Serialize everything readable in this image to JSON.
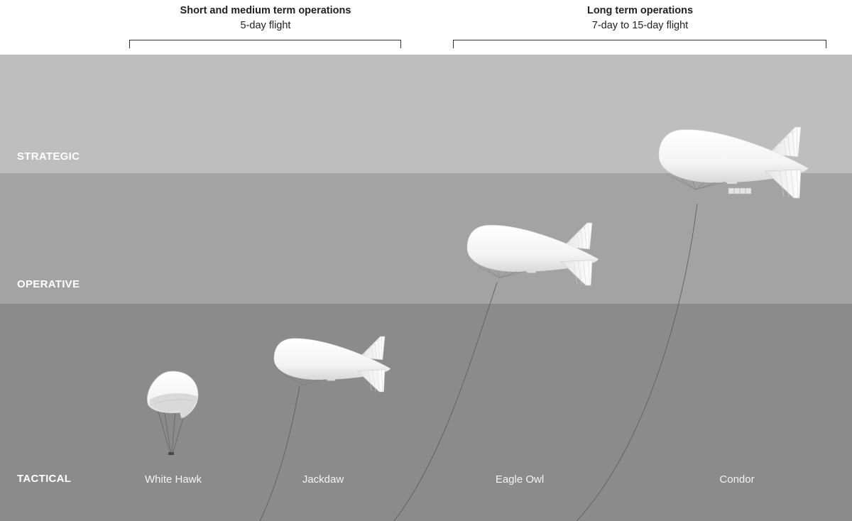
{
  "groups": [
    {
      "title": "Short and medium term operations",
      "subtitle": "5-day flight"
    },
    {
      "title": "Long term operations",
      "subtitle": "7-day to 15-day flight"
    }
  ],
  "levels": [
    {
      "label": "STRATEGIC",
      "color": "#bebebe"
    },
    {
      "label": "OPERATIVE",
      "color": "#a3a3a3"
    },
    {
      "label": "TACTICAL",
      "color": "#8b8b8b"
    }
  ],
  "balloons": [
    {
      "name": "White Hawk",
      "kind": "spherical-aerostat"
    },
    {
      "name": "Jackdaw",
      "kind": "blimp"
    },
    {
      "name": "Eagle Owl",
      "kind": "blimp"
    },
    {
      "name": "Condor",
      "kind": "blimp"
    }
  ]
}
